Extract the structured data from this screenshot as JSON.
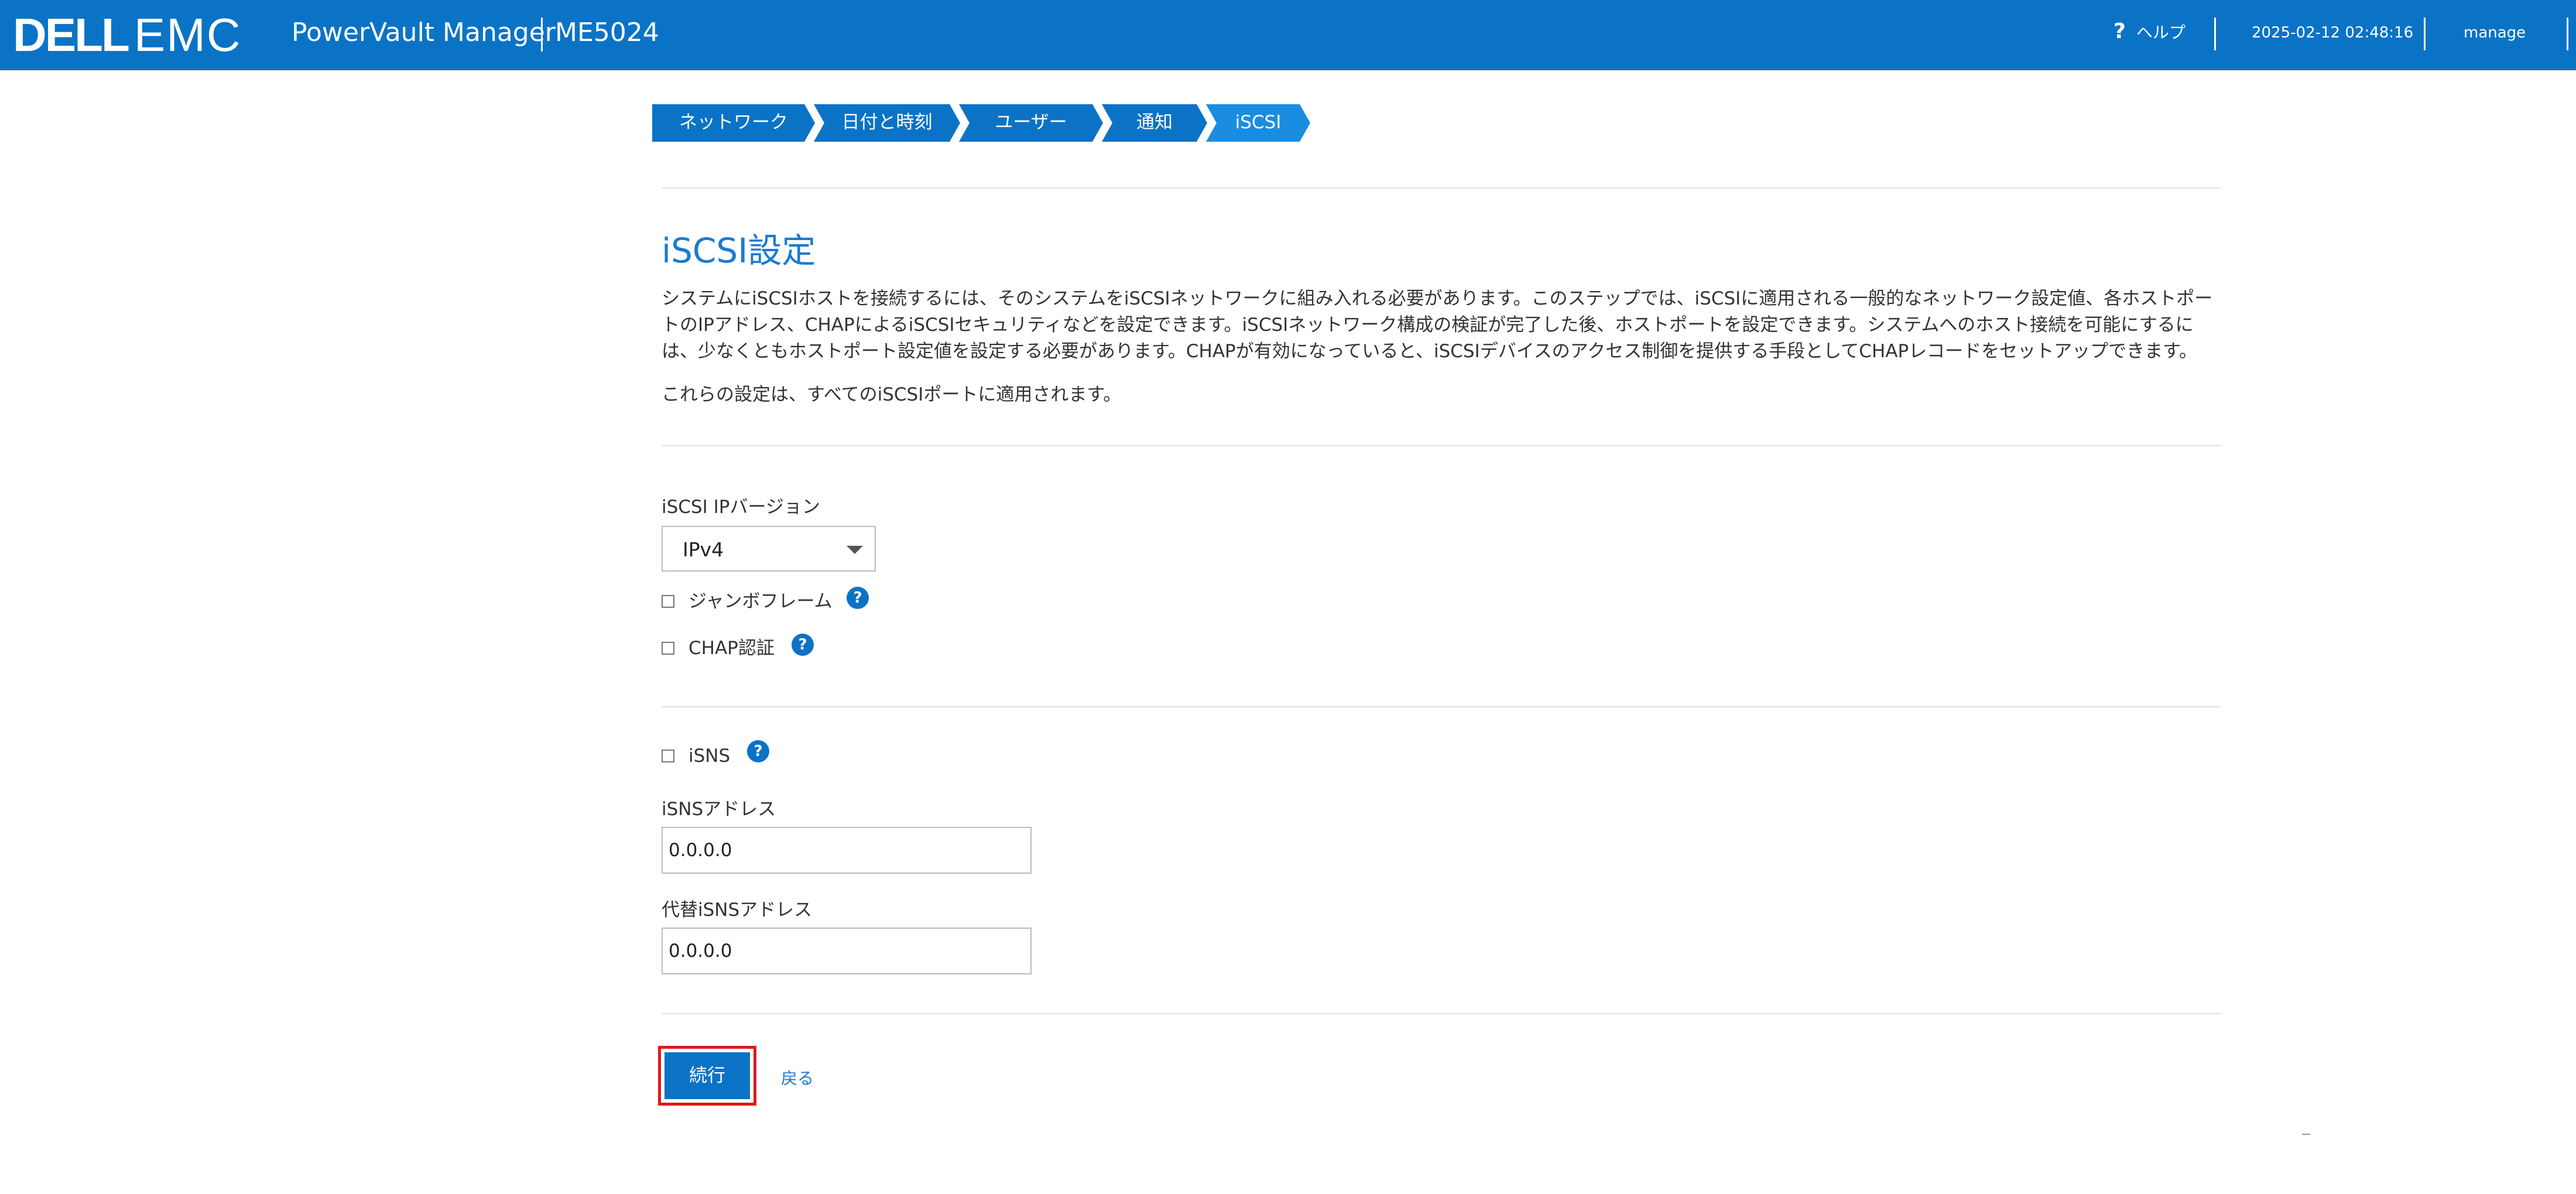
{
  "header": {
    "logo_dell": "DELL",
    "logo_emc": "EMC",
    "app_title": "PowerVault Manager",
    "model": "ME5024",
    "help_label": "ヘルプ",
    "datetime": "2025-02-12 02:48:16",
    "user": "manage"
  },
  "wizard": {
    "steps": [
      {
        "label": "ネットワーク",
        "active": false
      },
      {
        "label": "日付と時刻",
        "active": false
      },
      {
        "label": "ユーザー",
        "active": false
      },
      {
        "label": "通知",
        "active": false
      },
      {
        "label": "iSCSI",
        "active": true
      }
    ]
  },
  "main": {
    "title": "iSCSI設定",
    "description": "システムにiSCSIホストを接続するには、そのシステムをiSCSIネットワークに組み入れる必要があります。このステップでは、iSCSIに適用される一般的なネットワーク設定値、各ホストポートのIPアドレス、CHAPによるiSCSIセキュリティなどを設定できます。iSCSIネットワーク構成の検証が完了した後、ホストポートを設定できます。システムへのホスト接続を可能にするには、少なくともホストポート設定値を設定する必要があります。CHAPが有効になっていると、iSCSIデバイスのアクセス制御を提供する手段としてCHAPレコードをセットアップできます。",
    "note": "これらの設定は、すべてのiSCSIポートに適用されます。",
    "ip_version_label": "iSCSI IPバージョン",
    "ip_version_value": "IPv4",
    "jumbo_frame_label": "ジャンボフレーム",
    "chap_label": "CHAP認証",
    "isns_label": "iSNS",
    "isns_address_label": "iSNSアドレス",
    "isns_address_value": "0.0.0.0",
    "alt_isns_address_label": "代替iSNSアドレス",
    "alt_isns_address_value": "0.0.0.0",
    "help_glyph": "?"
  },
  "footer": {
    "continue_label": "続行",
    "back_label": "戻る"
  },
  "colors": {
    "brand_blue": "#0b73c6",
    "active_step": "#1a8de0",
    "title_blue": "#1a7bd0",
    "highlight_red": "#e11919"
  }
}
